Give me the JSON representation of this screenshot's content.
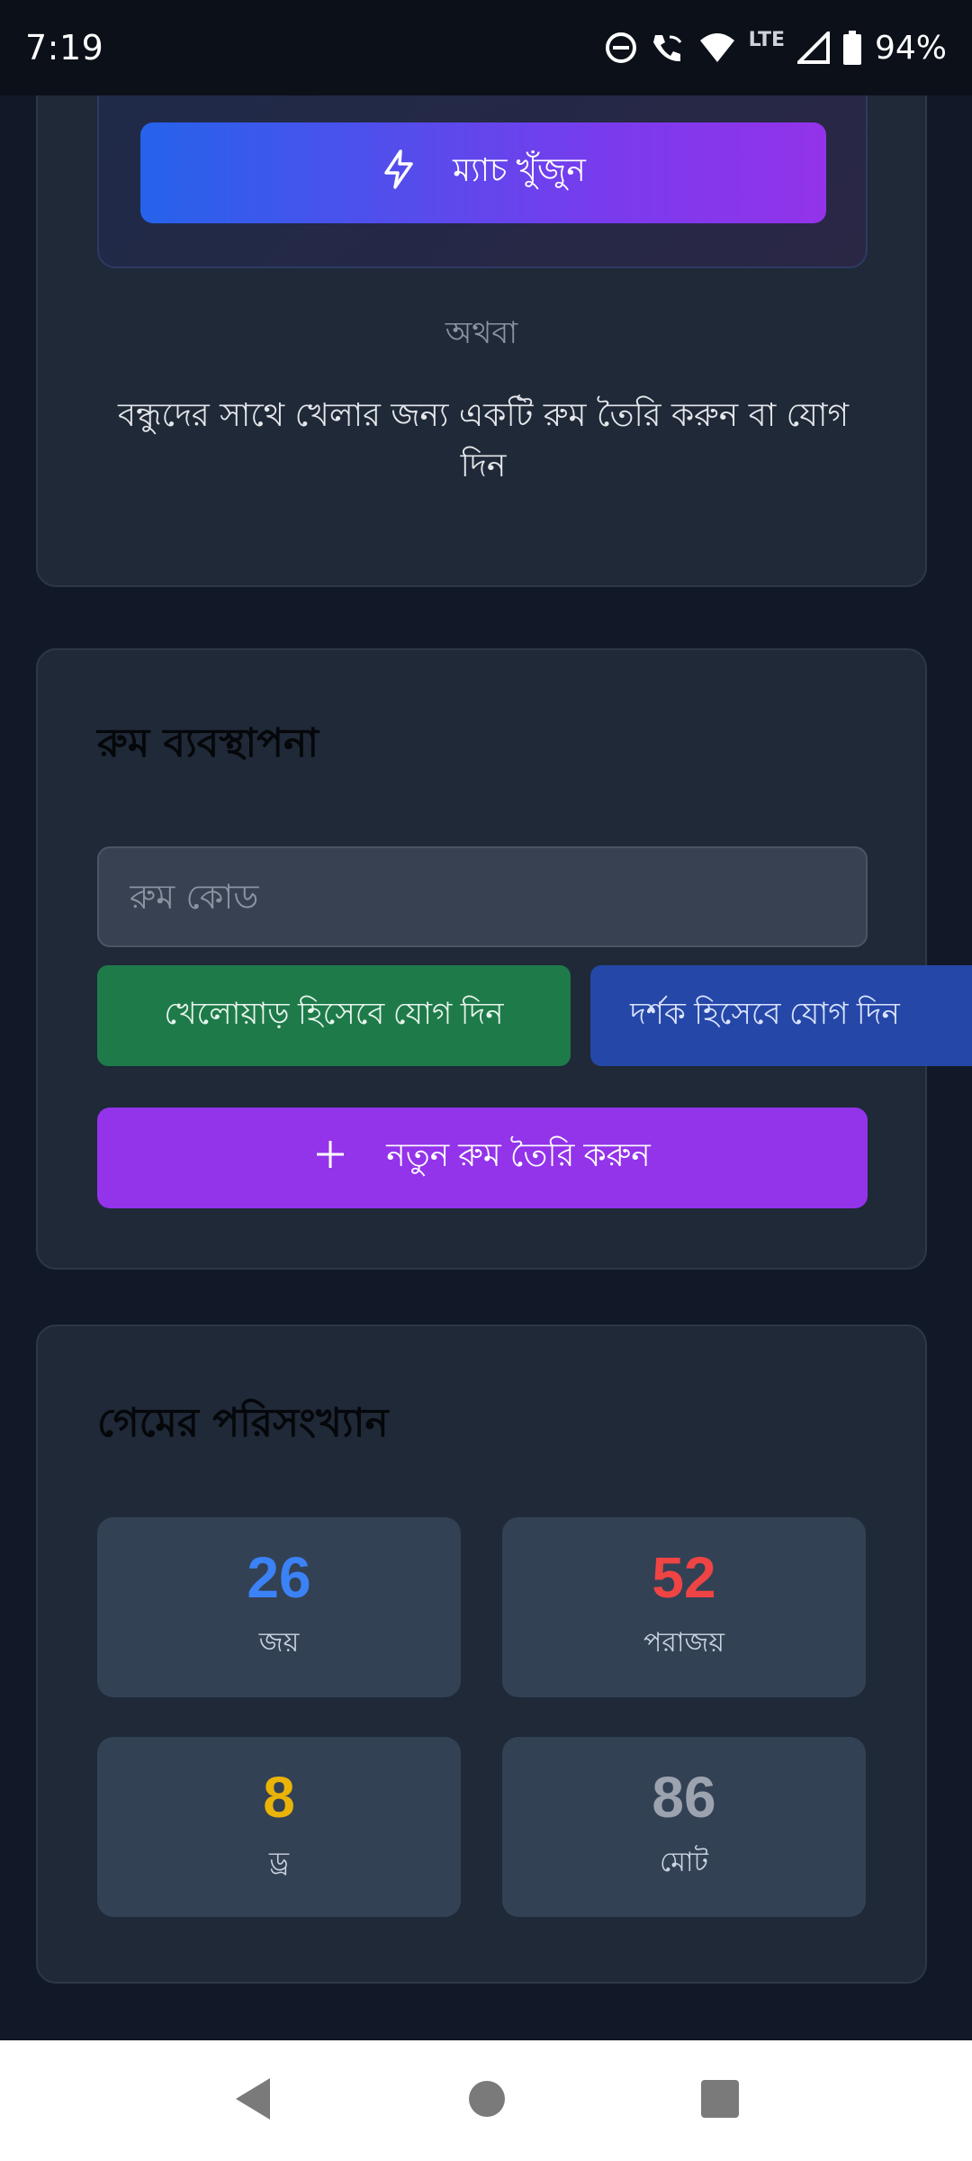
{
  "status_bar": {
    "time": "7:19",
    "network": "LTE",
    "battery": "94%"
  },
  "matchmaking": {
    "find_match_label": "ম্যাচ খুঁজুন",
    "or_label": "অথবা",
    "info": "বন্ধুদের সাথে খেলার জন্য একটি রুম তৈরি করুন বা যোগ দিন"
  },
  "room_management": {
    "title": "রুম ব্যবস্থাপনা",
    "room_code_placeholder": "রুম কোড",
    "join_player_label": "খেলোয়াড় হিসেবে যোগ দিন",
    "join_spectator_label": "দর্শক হিসেবে যোগ দিন",
    "create_room_label": "নতুন রুম তৈরি করুন"
  },
  "stats": {
    "title": "গেমের পরিসংখ্যান",
    "items": [
      {
        "value": "26",
        "label": "জয়",
        "color": "#3b82f6"
      },
      {
        "value": "52",
        "label": "পরাজয়",
        "color": "#ef4444"
      },
      {
        "value": "8",
        "label": "ড্র",
        "color": "#eab308"
      },
      {
        "value": "86",
        "label": "মোট",
        "color": "#9ca3af"
      }
    ]
  },
  "colors": {
    "background": "#111827",
    "card": "#1f2937",
    "join_player": "#1f7a4a",
    "join_spectator": "#2547a7",
    "create_room": "#9333ea"
  },
  "icons": {
    "find_match": "lightning-icon",
    "create_room": "plus-icon",
    "nav_back": "back-triangle-icon",
    "nav_home": "home-circle-icon",
    "nav_recents": "recents-square-icon"
  }
}
